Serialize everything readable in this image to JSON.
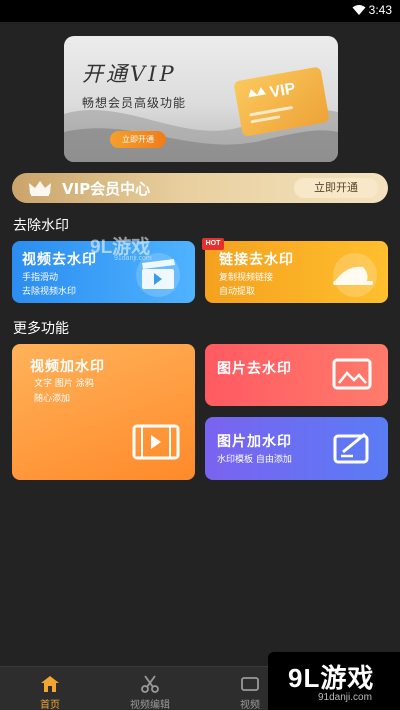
{
  "status": {
    "time": "3:43"
  },
  "banner": {
    "title": "开通VIP",
    "subtitle": "畅想会员高级功能",
    "button": "立即开通",
    "card_text": "VIP"
  },
  "vip_center": {
    "label": "VIP会员中心",
    "button": "立即开通"
  },
  "sections": {
    "remove": "去除水印",
    "more": "更多功能"
  },
  "tiles": {
    "video_remove": {
      "title": "视频去水印",
      "desc1": "手指滑动",
      "desc2": "去除视频水印"
    },
    "link_remove": {
      "badge": "HOT",
      "title": "链接去水印",
      "desc1": "复制视频链接",
      "desc2": "自动提取"
    },
    "video_add": {
      "title": "视频加水印",
      "desc1": "文字 图片 涂鸦",
      "desc2": "随心添加"
    },
    "image_remove": {
      "title": "图片去水印"
    },
    "image_add": {
      "title": "图片加水印",
      "desc1": "水印模板  自由添加"
    }
  },
  "watermark": {
    "main": "9L游戏",
    "sub": "91danji.com"
  },
  "nav": [
    {
      "label": "首页",
      "icon": "home-icon",
      "active": true
    },
    {
      "label": "视频编辑",
      "icon": "scissors-icon",
      "active": false
    },
    {
      "label": "视频",
      "icon": "video-icon",
      "active": false
    }
  ],
  "brand": {
    "main": "9L游戏",
    "sub": "91danji.com"
  },
  "colors": {
    "accent": "#f3a532",
    "background": "#232323"
  }
}
